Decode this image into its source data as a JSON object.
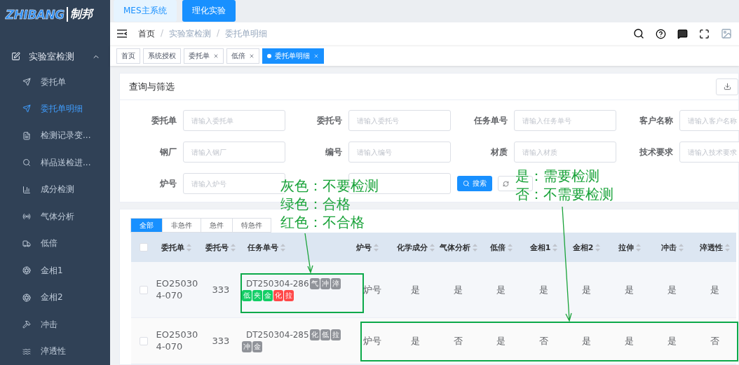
{
  "logo": {
    "latin": "ZHIBANG",
    "chinese": "制邦"
  },
  "system_tabs": [
    {
      "label": "MES主系统",
      "selected": false
    },
    {
      "label": "理化实验",
      "selected": true
    }
  ],
  "sidebar": {
    "group": {
      "label": "实验室检测",
      "expanded": true
    },
    "items": [
      {
        "label": "委托单",
        "selected": false
      },
      {
        "label": "委托单明细",
        "selected": true
      },
      {
        "label": "检测记录变...",
        "selected": false
      },
      {
        "label": "样品送检进...",
        "selected": false
      },
      {
        "label": "成分检测",
        "selected": false
      },
      {
        "label": "气体分析",
        "selected": false
      },
      {
        "label": "低倍",
        "selected": false
      },
      {
        "label": "金相1",
        "selected": false
      },
      {
        "label": "金相2",
        "selected": false
      },
      {
        "label": "冲击",
        "selected": false
      },
      {
        "label": "淬透性",
        "selected": false
      }
    ]
  },
  "breadcrumb": [
    "首页",
    "实验室检测",
    "委托单明细"
  ],
  "breadcrumb_separator": "/",
  "page_tags": [
    {
      "label": "首页",
      "closable": false,
      "selected": false
    },
    {
      "label": "系统授权",
      "closable": false,
      "selected": false
    },
    {
      "label": "委托单",
      "closable": true,
      "selected": false
    },
    {
      "label": "低倍",
      "closable": true,
      "selected": false
    },
    {
      "label": "委托单明细",
      "closable": true,
      "selected": true
    }
  ],
  "filter": {
    "title": "查询与筛选",
    "fields": [
      {
        "kind": "text",
        "label": "委托单",
        "placeholder": "请输入委托单"
      },
      {
        "kind": "text",
        "label": "委托号",
        "placeholder": "请输入委托号"
      },
      {
        "kind": "text",
        "label": "任务单号",
        "placeholder": "请输入任务单号"
      },
      {
        "kind": "text",
        "label": "客户名称",
        "placeholder": "请输入客户名称"
      },
      {
        "kind": "text",
        "label": "钢厂",
        "placeholder": "请输入钢厂"
      },
      {
        "kind": "text",
        "label": "编号",
        "placeholder": "请输入编号"
      },
      {
        "kind": "text",
        "label": "材质",
        "placeholder": "请输入材质"
      },
      {
        "kind": "text",
        "label": "技术要求",
        "placeholder": "请输入技术要求"
      },
      {
        "kind": "text",
        "label": "炉号",
        "placeholder": "请输入炉号"
      },
      {
        "kind": "text"
      }
    ],
    "search_button": "搜索"
  },
  "urgency_tabs": [
    {
      "label": "全部",
      "selected": true
    },
    {
      "label": "非急件",
      "selected": false
    },
    {
      "label": "急件",
      "selected": false
    },
    {
      "label": "特急件",
      "selected": false
    }
  ],
  "table": {
    "select_all_checked": false,
    "columns": [
      "委托单",
      "委托号",
      "任务单号",
      "炉号",
      "化学成分",
      "气体分析",
      "低倍",
      "金相1",
      "金相2",
      "拉伸",
      "冲击",
      "淬透性"
    ],
    "rows": [
      {
        "checked": false,
        "order": "EO250304-070",
        "order_no": "333",
        "task_no": "DT250304-286",
        "tags": [
          {
            "label": "气",
            "color": "#909399"
          },
          {
            "label": "冲",
            "color": "#909399"
          },
          {
            "label": "淬",
            "color": "#909399"
          },
          {
            "label": "低",
            "color": "#13ce66"
          },
          {
            "label": "夹",
            "color": "#13ce66"
          },
          {
            "label": "金",
            "color": "#13ce66"
          },
          {
            "label": "化",
            "color": "#ff4949"
          },
          {
            "label": "拉",
            "color": "#ff4949"
          }
        ],
        "values": [
          "炉号",
          "是",
          "是",
          "是",
          "是",
          "是",
          "是",
          "是",
          "是"
        ]
      },
      {
        "checked": false,
        "order": "EO250304-070",
        "order_no": "333",
        "task_no": "DT250304-285",
        "tags": [
          {
            "label": "化",
            "color": "#909399"
          },
          {
            "label": "低",
            "color": "#909399"
          },
          {
            "label": "拉",
            "color": "#909399"
          },
          {
            "label": "冲",
            "color": "#909399"
          },
          {
            "label": "金",
            "color": "#909399"
          }
        ],
        "values": [
          "炉号",
          "是",
          "否",
          "是",
          "否",
          "是",
          "是",
          "是",
          "否"
        ]
      }
    ]
  },
  "annotations": {
    "color_legend": [
      "灰色：不要检测",
      "绿色：合格",
      "红色：不合格"
    ],
    "value_legend": [
      "是：需要检测",
      "否：不需要检测"
    ]
  }
}
